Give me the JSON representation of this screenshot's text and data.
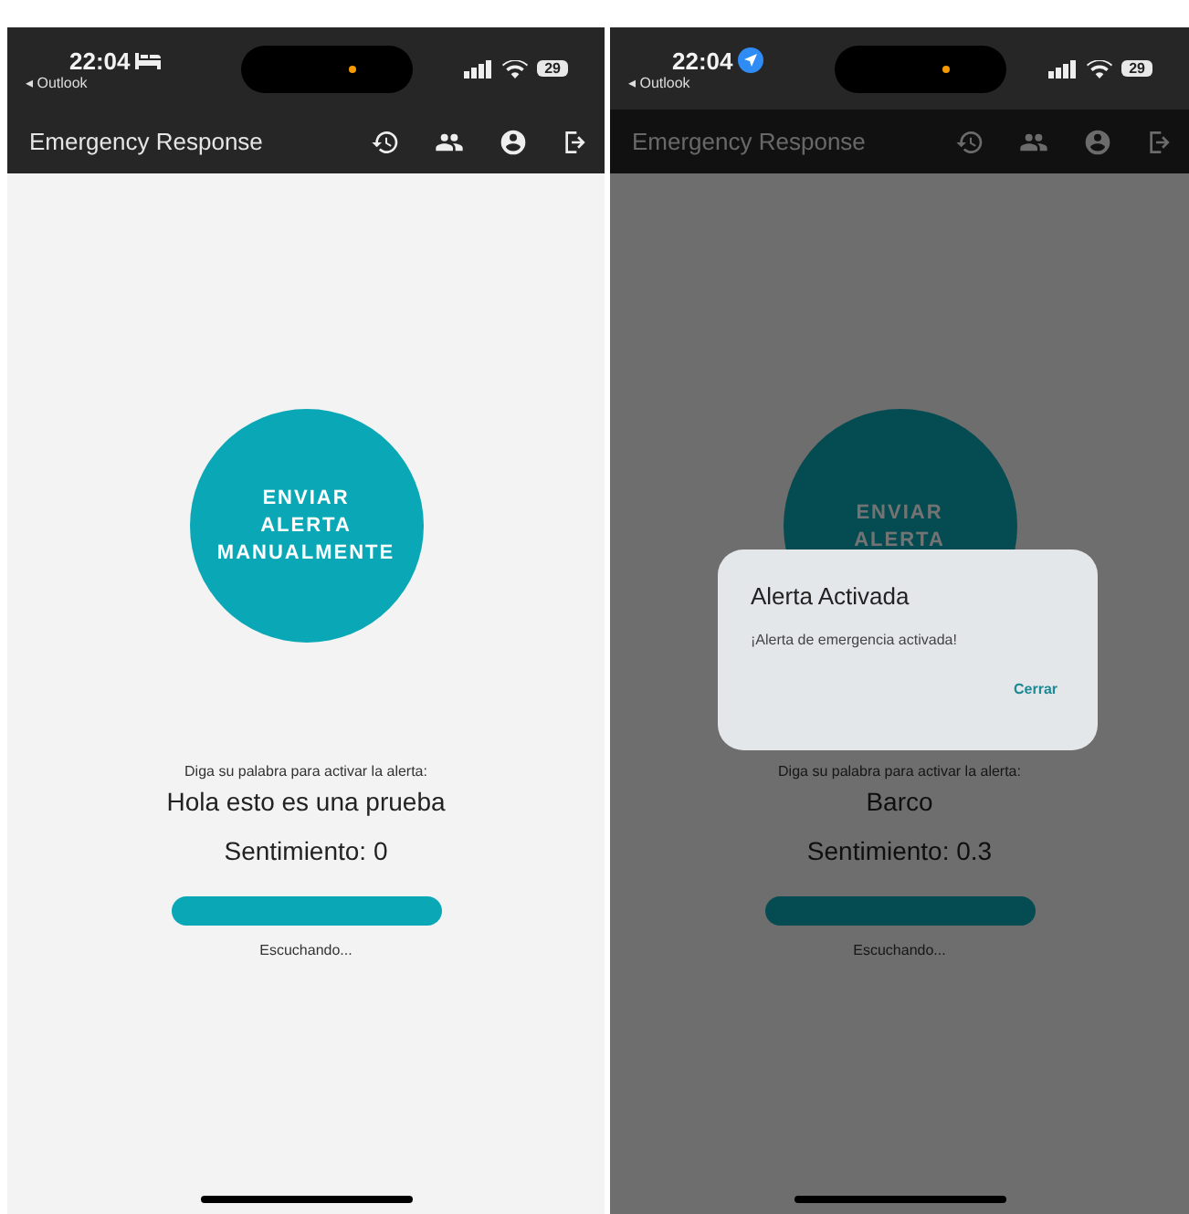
{
  "phones": [
    {
      "status_bar": {
        "time": "22:04",
        "indicator": {
          "kind": "bed"
        },
        "back_label": "◂ Outlook",
        "battery": "29"
      },
      "app_bar": {
        "title": "Emergency Response"
      },
      "alert_button": {
        "lines": [
          "ENVIAR",
          "ALERTA",
          "MANUALMENTE"
        ]
      },
      "prompt": "Diga su palabra para activar la alerta:",
      "transcript": "Hola esto es una prueba",
      "sentiment": "Sentimiento: 0",
      "listening": "Escuchando..."
    },
    {
      "status_bar": {
        "time": "22:04",
        "indicator": {
          "kind": "location"
        },
        "back_label": "◂ Outlook",
        "battery": "29"
      },
      "app_bar": {
        "title": "Emergency Response"
      },
      "alert_button": {
        "lines": [
          "ENVIAR",
          "ALERTA"
        ]
      },
      "prompt": "Diga su palabra para activar la alerta:",
      "transcript": "Barco",
      "sentiment": "Sentimiento: 0.3",
      "listening": "Escuchando...",
      "dialog": {
        "title": "Alerta Activada",
        "message": "¡Alerta de emergencia activada!",
        "button": "Cerrar"
      }
    }
  ]
}
